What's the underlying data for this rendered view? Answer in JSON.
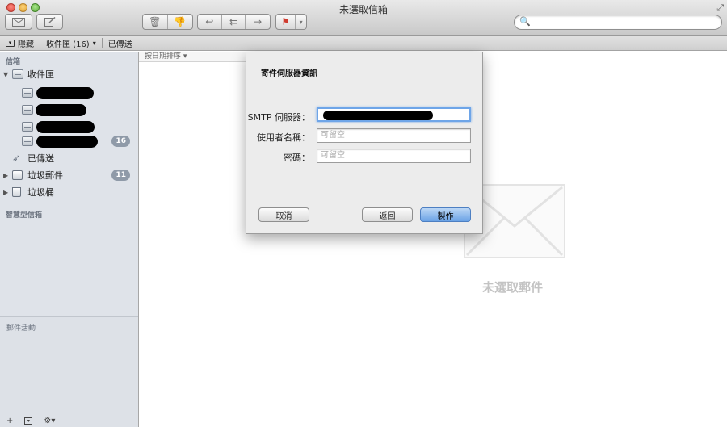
{
  "window": {
    "title": "未選取信箱"
  },
  "search": {
    "placeholder": ""
  },
  "favbar": {
    "hide_label": "隱藏",
    "inbox_label": "收件匣 (16)",
    "sent_label": "已傳送"
  },
  "sidebar": {
    "mailboxes_header": "信箱",
    "inbox_label": "收件匣",
    "account4_badge": "16",
    "sent_label": "已傳送",
    "junk_label": "垃圾郵件",
    "junk_badge": "11",
    "trash_label": "垃圾桶",
    "smart_header": "智慧型信箱",
    "activity_label": "郵件活動",
    "footer": {
      "add": "+",
      "gear": "⚙▾"
    }
  },
  "message_list": {
    "sort_label": "按日期排序 ▾"
  },
  "viewer": {
    "no_message": "未選取郵件"
  },
  "dialog": {
    "title": "寄件伺服器資訊",
    "smtp_label": "SMTP 伺服器：",
    "username_label": "使用者名稱：",
    "username_placeholder": "可留空",
    "password_label": "密碼：",
    "password_placeholder": "可留空",
    "cancel": "取消",
    "back": "返回",
    "create": "製作"
  }
}
